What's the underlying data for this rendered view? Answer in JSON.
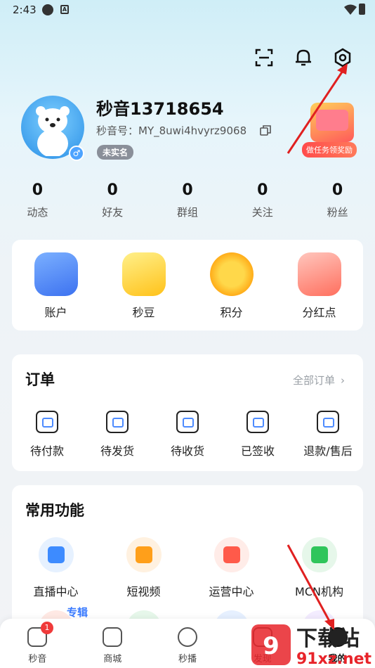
{
  "status_bar": {
    "time": "2:43"
  },
  "profile": {
    "username": "秒音13718654",
    "user_id": "秒音号：MY_8uwi4hvyrz9068",
    "badge": "未实名",
    "gender": "♂",
    "reward_label": "做任务领奖励"
  },
  "stats": [
    {
      "value": "0",
      "label": "动态"
    },
    {
      "value": "0",
      "label": "好友"
    },
    {
      "value": "0",
      "label": "群组"
    },
    {
      "value": "0",
      "label": "关注"
    },
    {
      "value": "0",
      "label": "粉丝"
    }
  ],
  "wallet": [
    {
      "label": "账户",
      "color": "#4a86ff"
    },
    {
      "label": "秒豆",
      "color": "#ffcf33"
    },
    {
      "label": "积分",
      "color": "#ffb300"
    },
    {
      "label": "分红点",
      "color": "#ff7a6b"
    }
  ],
  "orders": {
    "title": "订单",
    "all_link": "全部订单",
    "items": [
      {
        "label": "待付款"
      },
      {
        "label": "待发货"
      },
      {
        "label": "待收货"
      },
      {
        "label": "已签收"
      },
      {
        "label": "退款/售后"
      }
    ]
  },
  "functions": {
    "title": "常用功能",
    "tag": "专辑",
    "items": [
      {
        "label": "直播中心",
        "bg": "#e6f1ff",
        "fg": "#3d8bff"
      },
      {
        "label": "短视频",
        "bg": "#fff1e0",
        "fg": "#ff9f1a"
      },
      {
        "label": "运营中心",
        "bg": "#ffece8",
        "fg": "#ff5a4a"
      },
      {
        "label": "MCN机构",
        "bg": "#e6f7ea",
        "fg": "#2fc55b"
      }
    ],
    "row2_colors": [
      "#ffe9e4",
      "#e6f7ea",
      "#e6f0ff",
      "#f3ecff"
    ]
  },
  "bottom_nav": [
    {
      "label": "秒音",
      "badge": "1"
    },
    {
      "label": "商城"
    },
    {
      "label": "秒播"
    },
    {
      "label": "发现"
    },
    {
      "label": "我的"
    }
  ],
  "watermark": {
    "text": "下载站",
    "sub": "91xz.net"
  }
}
